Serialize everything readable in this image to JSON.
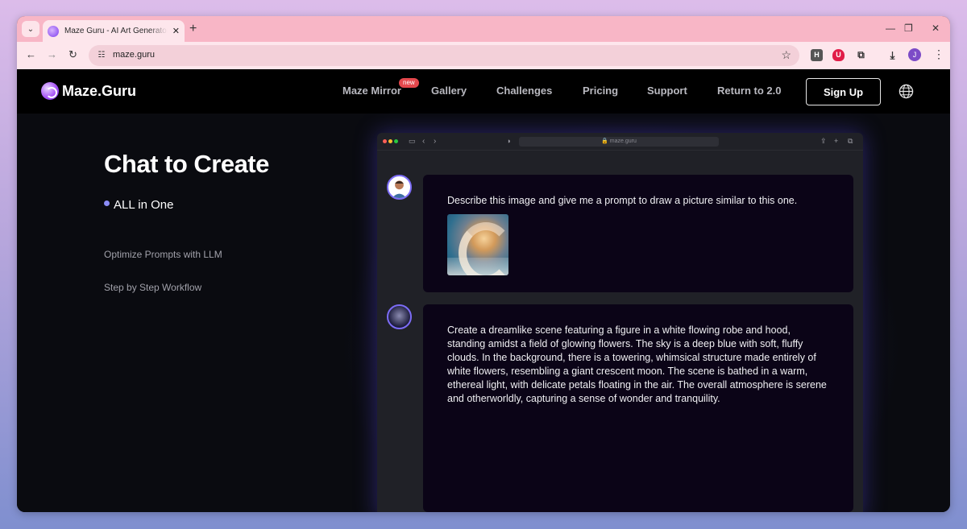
{
  "browser": {
    "tab_title": "Maze Guru - AI Art Generator - ",
    "new_tab": "+",
    "url": "maze.guru",
    "profile_initial": "J",
    "ext_h": "H"
  },
  "site": {
    "brand": "Maze.Guru",
    "nav": {
      "maze_mirror": "Maze Mirror",
      "new_badge": "new",
      "gallery": "Gallery",
      "challenges": "Challenges",
      "pricing": "Pricing",
      "support": "Support",
      "return": "Return to 2.0"
    },
    "signup": "Sign Up"
  },
  "hero": {
    "title": "Chat to Create",
    "features": [
      "ALL in One",
      "Optimize Prompts with LLM",
      "Step by Step Workflow"
    ]
  },
  "mock": {
    "url": "🔒 maze.guru",
    "messages": [
      {
        "role": "user",
        "text": "Describe this image and give me a prompt to draw a picture similar to this one."
      },
      {
        "role": "bot",
        "text": "Create a dreamlike scene featuring a figure in a white flowing robe and hood, standing amidst a field of glowing flowers. The sky is a deep blue with soft, fluffy clouds. In the background, there is a towering, whimsical structure made entirely of white flowers, resembling a giant crescent moon. The scene is bathed in a warm, ethereal light, with delicate petals floating in the air. The overall atmosphere is serene and otherworldly, capturing a sense of wonder and tranquility."
      }
    ]
  }
}
